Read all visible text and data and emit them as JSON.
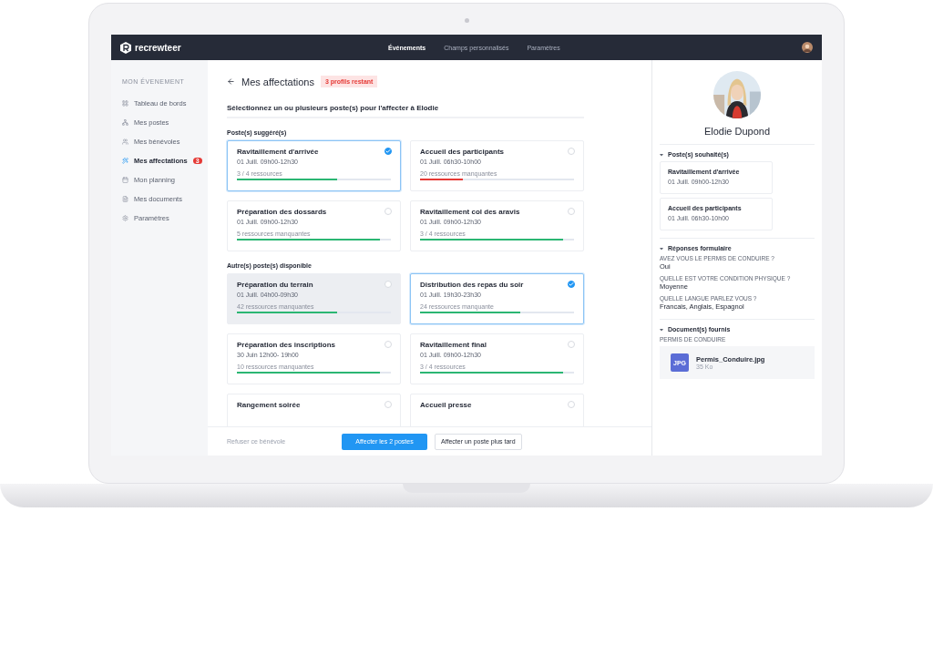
{
  "nav": {
    "brand": "recrewteer",
    "links": [
      {
        "label": "Événements",
        "selected": true
      },
      {
        "label": "Champs personnalisés",
        "selected": false
      },
      {
        "label": "Paramètres",
        "selected": false
      }
    ]
  },
  "sidebar": {
    "heading": "MON ÉVENEMENT",
    "items": [
      {
        "label": "Tableau de bords",
        "selected": false
      },
      {
        "label": "Mes postes",
        "selected": false
      },
      {
        "label": "Mes bénévoles",
        "selected": false
      },
      {
        "label": "Mes affectations",
        "selected": true,
        "badge": "3"
      },
      {
        "label": "Mon planning",
        "selected": false
      },
      {
        "label": "Mes documents",
        "selected": false
      },
      {
        "label": "Paramètres",
        "selected": false
      }
    ]
  },
  "main": {
    "title": "Mes affectations",
    "remaining": "3 profils restant",
    "instruction": "Sélectionnez un ou plusieurs poste(s) pour l'affecter à Elodie",
    "sections": [
      {
        "heading": "Poste(s) suggéré(s)",
        "posts": [
          {
            "title": "Ravitaillement d'arrivée",
            "date": "01 Juill. 09h00-12h30",
            "resources": "3 / 4 ressources",
            "level": 0.65,
            "color": "#2bb673",
            "selected": true,
            "hovered": false
          },
          {
            "title": "Accueil des participants",
            "date": "01 Juill. 06h30-10h00",
            "resources": "20 ressources manquantes",
            "level": 0.28,
            "color": "#e53935",
            "selected": false,
            "hovered": false
          },
          {
            "title": "Préparation des dossards",
            "date": "01 Juill. 09h00-12h30",
            "resources": "5 ressources manquantes",
            "level": 0.93,
            "color": "#2bb673",
            "selected": false,
            "hovered": false
          },
          {
            "title": "Ravitaillement col des aravis",
            "date": "01 Juill. 09h00-12h30",
            "resources": "3 / 4 ressources",
            "level": 0.93,
            "color": "#2bb673",
            "selected": false,
            "hovered": false
          }
        ]
      },
      {
        "heading": "Autre(s) poste(s) disponible",
        "posts": [
          {
            "title": "Préparation du terrain",
            "date": "01 Juill. 04h00-09h30",
            "resources": "42 ressources manquantes",
            "level": 0.65,
            "color": "#2bb673",
            "selected": false,
            "hovered": true
          },
          {
            "title": "Distribution des repas du soir",
            "date": "01 Juill. 19h30-23h30",
            "resources": "24 ressources manquante",
            "level": 0.65,
            "color": "#2bb673",
            "selected": true,
            "hovered": false
          },
          {
            "title": "Préparation des inscriptions",
            "date": "30 Juin 12h00- 19h00",
            "resources": "10 ressources manquantes",
            "level": 0.93,
            "color": "#2bb673",
            "selected": false,
            "hovered": false
          },
          {
            "title": "Ravitaillement final",
            "date": "01 Juill. 09h00-12h30",
            "resources": "3 / 4 ressources",
            "level": 0.93,
            "color": "#2bb673",
            "selected": false,
            "hovered": false
          },
          {
            "title": "Rangement soirée",
            "selected": false,
            "hovered": false
          },
          {
            "title": "Accueil presse",
            "selected": false,
            "hovered": false
          }
        ]
      }
    ]
  },
  "footer": {
    "refuse": "Refuser ce bénévole",
    "primary": "Affecter les 2 postes",
    "secondary": "Affecter un poste plus tard"
  },
  "profile": {
    "name": "Elodie Dupond",
    "wished": {
      "heading": "Poste(s) souhaité(s)",
      "expanded": true,
      "posts": [
        {
          "title": "Ravitaillement d'arrivée",
          "date": "01 Juill. 09h00-12h30"
        },
        {
          "title": "Accueil des participants",
          "date": "01 Juill. 06h30-10h00"
        }
      ]
    },
    "answers": {
      "heading": "Réponses formulaire",
      "expanded": true,
      "items": [
        {
          "question": "AVEZ VOUS LE PERMIS DE CONDUIRE ?",
          "answer": "Oui"
        },
        {
          "question": "QUELLE EST VOTRE CONDITION PHYSIQUE ?",
          "answer": "Moyenne"
        },
        {
          "question": "QUELLE LANGUE PARLEZ VOUS ?",
          "answer": "Francais, Anglais, Espagnol"
        }
      ]
    },
    "documents": {
      "heading": "Document(s) fournis",
      "expanded": true,
      "label": "PERMIS DE CONDUIRE",
      "file": {
        "type": "JPG",
        "name": "Permis_Conduire.jpg",
        "size": "35 Ko"
      }
    }
  }
}
